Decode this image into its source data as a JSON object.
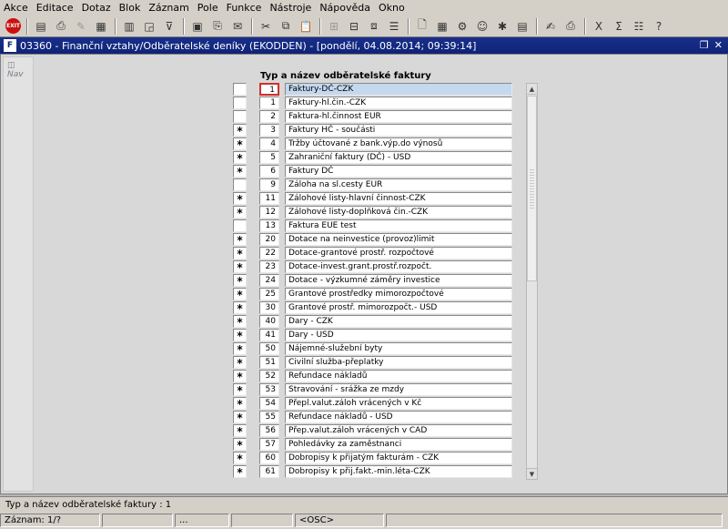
{
  "menu": [
    "Akce",
    "Editace",
    "Dotaz",
    "Blok",
    "Záznam",
    "Pole",
    "Funkce",
    "Nástroje",
    "Nápověda",
    "Okno"
  ],
  "toolbar": {
    "exit_text": "EXIT",
    "buttons": [
      {
        "name": "save-icon",
        "glyph": "▤"
      },
      {
        "name": "print-icon",
        "glyph": "⎙"
      },
      {
        "name": "clear-icon",
        "glyph": "✎"
      },
      {
        "name": "block-icon",
        "glyph": "▦"
      },
      {
        "name": "record-icon",
        "glyph": "▥"
      },
      {
        "name": "enter-query-icon",
        "glyph": "◲"
      },
      {
        "name": "filter-icon",
        "glyph": "⊽"
      },
      {
        "name": "save-record-icon",
        "glyph": "▣"
      },
      {
        "name": "print-record-icon",
        "glyph": "⎘"
      },
      {
        "name": "mail-icon",
        "glyph": "✉"
      },
      {
        "name": "cut-icon",
        "glyph": "✂"
      },
      {
        "name": "copy-icon",
        "glyph": "⧉"
      },
      {
        "name": "paste-icon",
        "glyph": "📋"
      },
      {
        "name": "insert-record-icon",
        "glyph": "⊞"
      },
      {
        "name": "delete-record-icon",
        "glyph": "⊟"
      },
      {
        "name": "duplicate-icon",
        "glyph": "⧈"
      },
      {
        "name": "lov-icon",
        "glyph": "☰"
      },
      {
        "name": "document-icon",
        "glyph": "🗋"
      },
      {
        "name": "calendar-icon",
        "glyph": "▦"
      },
      {
        "name": "settings-icon",
        "glyph": "⚙"
      },
      {
        "name": "user-icon",
        "glyph": "☺"
      },
      {
        "name": "tools-icon",
        "glyph": "✱"
      },
      {
        "name": "notes-icon",
        "glyph": "▤"
      },
      {
        "name": "edit-icon",
        "glyph": "✍"
      },
      {
        "name": "print-preview-icon",
        "glyph": "⎙"
      },
      {
        "name": "excel-icon",
        "glyph": "X"
      },
      {
        "name": "sum-icon",
        "glyph": "Σ"
      },
      {
        "name": "list-icon",
        "glyph": "☷"
      },
      {
        "name": "help-icon",
        "glyph": "?"
      }
    ]
  },
  "window": {
    "title": "03360 - Finanční vztahy/Odběratelské deníky (EKODDEN) - [pondělí, 04.08.2014; 09:39:14]",
    "icon_text": "F"
  },
  "nav": {
    "label": "Nav"
  },
  "grid": {
    "header": "Typ a název odběratelské faktury",
    "current_index": 0,
    "rows": [
      {
        "flag": "",
        "num": "1",
        "name": "Faktury-DČ-CZK"
      },
      {
        "flag": "",
        "num": "1",
        "name": "Faktury-hl.čin.-CZK"
      },
      {
        "flag": "",
        "num": "2",
        "name": "Faktura-hl.činnost EUR"
      },
      {
        "flag": "*",
        "num": "3",
        "name": "Faktury HČ - součásti"
      },
      {
        "flag": "*",
        "num": "4",
        "name": "Tržby účtované z bank.výp.do výnosů"
      },
      {
        "flag": "*",
        "num": "5",
        "name": "Zahraniční faktury (DČ) - USD"
      },
      {
        "flag": "*",
        "num": "6",
        "name": "Faktury DČ"
      },
      {
        "flag": "",
        "num": "9",
        "name": "Záloha na sl.cesty EUR"
      },
      {
        "flag": "*",
        "num": "11",
        "name": "Zálohové listy-hlavní činnost-CZK"
      },
      {
        "flag": "*",
        "num": "12",
        "name": "Zálohové listy-doplňková čin.-CZK"
      },
      {
        "flag": "",
        "num": "13",
        "name": "Faktura EUE test"
      },
      {
        "flag": "*",
        "num": "20",
        "name": "Dotace na neinvestice (provoz)limit"
      },
      {
        "flag": "*",
        "num": "22",
        "name": "Dotace-grantové prostř. rozpočtové"
      },
      {
        "flag": "*",
        "num": "23",
        "name": "Dotace-invest.grant.prostř.rozpočt."
      },
      {
        "flag": "*",
        "num": "24",
        "name": "Dotace - výzkumné záměry investice"
      },
      {
        "flag": "*",
        "num": "25",
        "name": "Grantové prostředky mimorozpočtové"
      },
      {
        "flag": "*",
        "num": "30",
        "name": "Grantové prostř. mimorozpočt.- USD"
      },
      {
        "flag": "*",
        "num": "40",
        "name": "Dary - CZK"
      },
      {
        "flag": "*",
        "num": "41",
        "name": "Dary - USD"
      },
      {
        "flag": "*",
        "num": "50",
        "name": "Nájemné-služební byty"
      },
      {
        "flag": "*",
        "num": "51",
        "name": "Civilní služba-přeplatky"
      },
      {
        "flag": "*",
        "num": "52",
        "name": "Refundace nákladů"
      },
      {
        "flag": "*",
        "num": "53",
        "name": "Stravování - srážka ze mzdy"
      },
      {
        "flag": "*",
        "num": "54",
        "name": "Přepl.valut.záloh vrácených v Kč"
      },
      {
        "flag": "*",
        "num": "55",
        "name": "Refundace nákladů - USD"
      },
      {
        "flag": "*",
        "num": "56",
        "name": "Přep.valut.záloh vrácených v CAD"
      },
      {
        "flag": "*",
        "num": "57",
        "name": "Pohledávky za zaměstnanci"
      },
      {
        "flag": "*",
        "num": "60",
        "name": "Dobropisy k přijatým fakturám - CZK"
      },
      {
        "flag": "*",
        "num": "61",
        "name": "Dobropisy k přij.fakt.-min.léta-CZK"
      }
    ]
  },
  "hint": "Typ a název odběratelské faktury : 1",
  "status": {
    "record": "Záznam: 1/?",
    "cell2": "",
    "cell3": "...",
    "cell4": "",
    "osc": "<OSC>",
    "cell6": ""
  }
}
